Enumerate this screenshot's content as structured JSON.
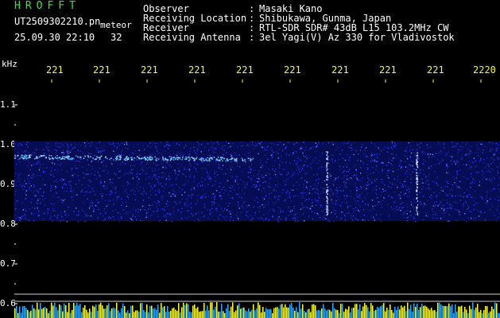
{
  "header": {
    "app_title": "HROFFT",
    "file_name": "UT2509302210.pn",
    "meteor_label": "meteor",
    "datetime": "25.09.30 22:10",
    "count": "32"
  },
  "info": [
    {
      "label": "Observer",
      "colon": ":",
      "value": "Masaki Kano"
    },
    {
      "label": "Receiving Location",
      "colon": ":",
      "value": "Shibukawa, Gunma, Japan"
    },
    {
      "label": "Receiver",
      "colon": ":",
      "value": "RTL-SDR SDR# 43dB L15 103.2MHz CW"
    },
    {
      "label": "Receiving Antenna",
      "colon": ":",
      "value": "3el Yagi(V) Az 330 for Vladivostok"
    }
  ],
  "axis": {
    "y_unit": "kHz",
    "x_ticks": [
      "221",
      "221",
      "221",
      "221",
      "221",
      "221",
      "221",
      "221",
      "221",
      "2220"
    ],
    "y_ticks": [
      "1.1",
      "1.0",
      "0.9",
      "0.8",
      "0.7",
      "0.6"
    ]
  },
  "colors": {
    "header_green": "#39e63a",
    "tick_yellow": "#f5f542",
    "signal_blue": "#2a3cff",
    "echo_cyan": "#9fe8ff",
    "noise_yellow": "#ffff33"
  }
}
